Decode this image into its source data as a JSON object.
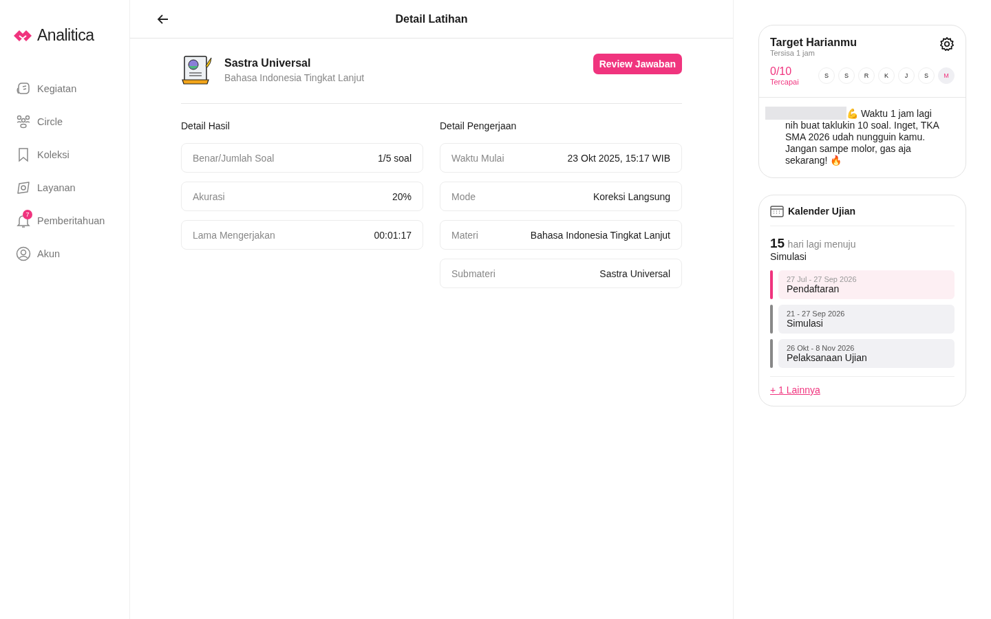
{
  "logo": {
    "text": "Analitica"
  },
  "sidebar": {
    "items": [
      {
        "label": "Kegiatan",
        "kind": "chat",
        "selected": false
      },
      {
        "label": "Circle",
        "kind": "people",
        "selected": false
      },
      {
        "label": "Koleksi",
        "kind": "bookmark",
        "selected": false
      },
      {
        "label": "Layanan",
        "kind": "service",
        "selected": false
      },
      {
        "label": "Pemberitahuan",
        "kind": "bell",
        "badge": "7",
        "selected": false
      },
      {
        "label": "Akun",
        "kind": "user",
        "selected": false
      }
    ]
  },
  "header": {
    "title": "Detail Latihan"
  },
  "subject": {
    "title": "Sastra Universal",
    "subtitle": "Bahasa Indonesia Tingkat Lanjut",
    "button": "Review Jawaban"
  },
  "results": {
    "title": "Detail Hasil",
    "rows": [
      {
        "label": "Benar/Jumlah Soal",
        "value": "1/5 soal"
      },
      {
        "label": "Akurasi",
        "value": "20%"
      },
      {
        "label": "Lama Mengerjakan",
        "value": "00:01:17"
      }
    ]
  },
  "work": {
    "title": "Detail Pengerjaan",
    "rows": [
      {
        "label": "Waktu Mulai",
        "value": "23 Okt 2025, 15:17 WIB"
      },
      {
        "label": "Mode",
        "value": "Koreksi Langsung"
      },
      {
        "label": "Materi",
        "value": "Bahasa Indonesia Tingkat Lanjut"
      },
      {
        "label": "Submateri",
        "value": "Sastra Universal"
      }
    ]
  },
  "target": {
    "title": "Target Harianmu",
    "subtitle": "Tersisa 1 jam",
    "progress": "0/10",
    "progress_label": "Tercapai",
    "days": [
      {
        "label": "S",
        "selected": false
      },
      {
        "label": "S",
        "selected": false
      },
      {
        "label": "R",
        "selected": false
      },
      {
        "label": "K",
        "selected": false
      },
      {
        "label": "J",
        "selected": false
      },
      {
        "label": "S",
        "selected": false
      },
      {
        "label": "M",
        "selected": true
      }
    ],
    "message_start": "💪 Waktu 1 jam lagi",
    "message": "nih buat taklukin 10 soal. Inget, TKA SMA 2026 udah nungguin kamu. Jangan sampe molor, gas aja sekarang! 🔥"
  },
  "calendar": {
    "title": "Kalender Ujian",
    "count": "15",
    "count_text": "hari lagi menuju",
    "target": "Simulasi",
    "events": [
      {
        "date": "27 Jul - 27 Sep 2026",
        "name": "Pendaftaran",
        "selected": true
      },
      {
        "date": "21 - 27 Sep 2026",
        "name": "Simulasi",
        "selected": false
      },
      {
        "date": "26 Okt - 8 Nov 2026",
        "name": "Pelaksanaan Ujian",
        "selected": false
      }
    ],
    "more": "+ 1 Lainnya"
  }
}
